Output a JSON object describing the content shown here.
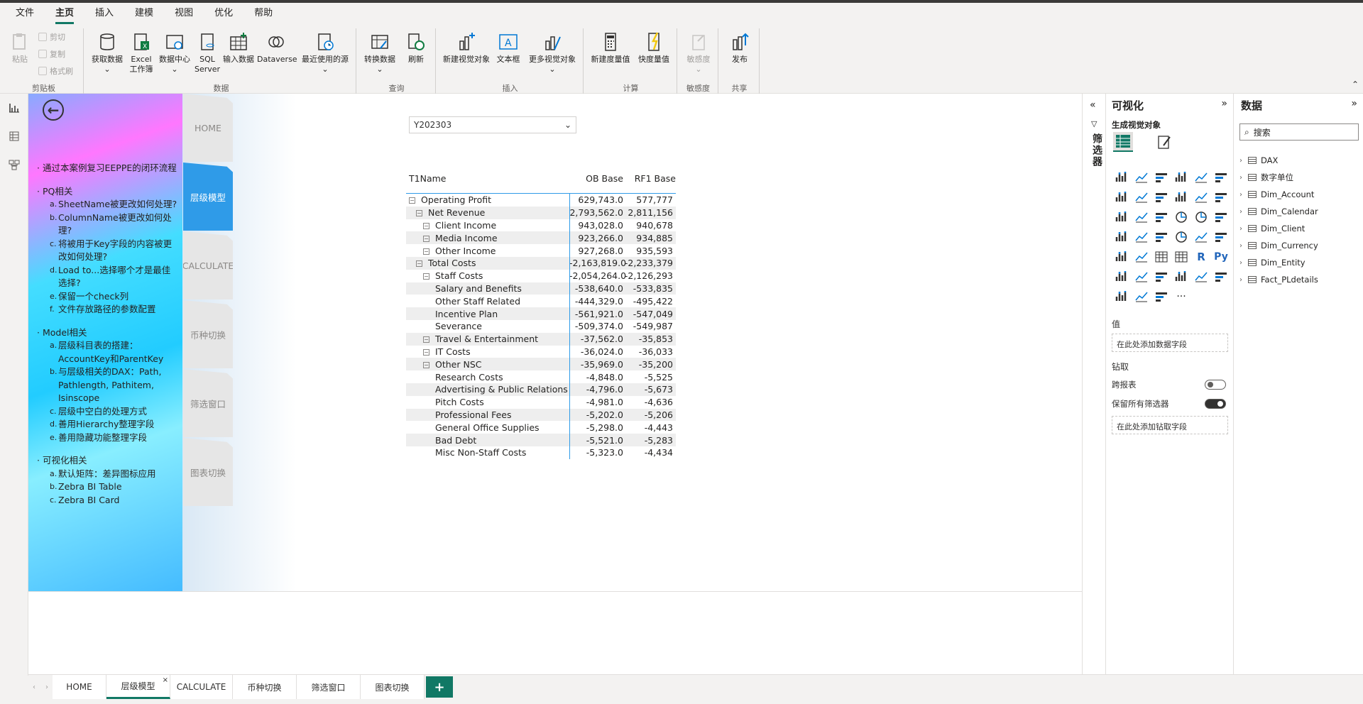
{
  "menu": [
    "文件",
    "主页",
    "插入",
    "建模",
    "视图",
    "优化",
    "帮助"
  ],
  "menu_active": "主页",
  "ribbon": {
    "clipboard": {
      "paste": "粘贴",
      "cut": "剪切",
      "copy": "复制",
      "format": "格式刷",
      "group": "剪贴板"
    },
    "data": {
      "get": "获取数据",
      "excel1": "Excel",
      "excel2": "工作簿",
      "hub": "数据中心",
      "sql1": "SQL",
      "sql2": "Server",
      "enter": "输入数据",
      "dataverse": "Dataverse",
      "recent": "最近使用的源",
      "group": "数据"
    },
    "query": {
      "transform": "转换数据",
      "refresh": "刷新",
      "group": "查询"
    },
    "insert": {
      "newvisual": "新建视觉对象",
      "textbox": "文本框",
      "morevisual": "更多视觉对象",
      "group": "插入"
    },
    "calc": {
      "newmeasure": "新建度量值",
      "quickmeasure": "快度量值",
      "group": "计算"
    },
    "sensitivity": {
      "label": "敏感度",
      "group": "敏感度"
    },
    "share": {
      "publish": "发布",
      "group": "共享"
    }
  },
  "outline": [
    {
      "title": "通过本案例复习EEPPE的闭环流程",
      "items": []
    },
    {
      "title": "PQ相关",
      "items": [
        {
          "m": "a.",
          "t": "SheetName被更改如何处理?"
        },
        {
          "m": "b.",
          "t": "ColumnName被更改如何处理?"
        },
        {
          "m": "c.",
          "t": "将被用于Key字段的内容被更改如何处理?"
        },
        {
          "m": "d.",
          "t": "Load to...选择哪个才是最佳选择?"
        },
        {
          "m": "e.",
          "t": "保留一个check列"
        },
        {
          "m": "f.",
          "t": "文件存放路径的参数配置"
        }
      ]
    },
    {
      "title": "Model相关",
      "items": [
        {
          "m": "a.",
          "t": "层级科目表的搭建：AccountKey和ParentKey"
        },
        {
          "m": "b.",
          "t": "与层级相关的DAX：Path, Pathlength, Pathitem, Isinscope"
        },
        {
          "m": "c.",
          "t": "层级中空白的处理方式"
        },
        {
          "m": "d.",
          "t": "善用Hierarchy整理字段"
        },
        {
          "m": "e.",
          "t": "善用隐藏功能整理字段"
        }
      ]
    },
    {
      "title": "可视化相关",
      "items": [
        {
          "m": "a.",
          "t": "默认矩阵：差异图标应用"
        },
        {
          "m": "b.",
          "t": "Zebra BI Table"
        },
        {
          "m": "c.",
          "t": "Zebra BI Card"
        }
      ]
    }
  ],
  "navtabs": [
    "HOME",
    "层级模型",
    "CALCULATE",
    "币种切换",
    "筛选窗口",
    "图表切换"
  ],
  "navtab_active": 1,
  "slicer": {
    "value": "Y202303"
  },
  "matrix": {
    "headers": [
      "T1Name",
      "OB Base",
      "RF1 Base"
    ],
    "rows": [
      {
        "name": "Operating Profit",
        "lvl": 0,
        "exp": true,
        "ob": "629,743.0",
        "rf": "577,777"
      },
      {
        "name": "Net Revenue",
        "lvl": 1,
        "exp": true,
        "ob": "2,793,562.0",
        "rf": "2,811,156"
      },
      {
        "name": "Client Income",
        "lvl": 2,
        "exp": true,
        "ob": "943,028.0",
        "rf": "940,678"
      },
      {
        "name": "Media Income",
        "lvl": 2,
        "exp": true,
        "ob": "923,266.0",
        "rf": "934,885"
      },
      {
        "name": "Other Income",
        "lvl": 2,
        "exp": true,
        "ob": "927,268.0",
        "rf": "935,593"
      },
      {
        "name": "Total Costs",
        "lvl": 1,
        "exp": true,
        "ob": "-2,163,819.0",
        "rf": "-2,233,379"
      },
      {
        "name": "Staff Costs",
        "lvl": 2,
        "exp": true,
        "ob": "-2,054,264.0",
        "rf": "-2,126,293"
      },
      {
        "name": "Salary and Benefits",
        "lvl": 3,
        "exp": false,
        "ob": "-538,640.0",
        "rf": "-533,835"
      },
      {
        "name": "Other Staff Related",
        "lvl": 3,
        "exp": false,
        "ob": "-444,329.0",
        "rf": "-495,422"
      },
      {
        "name": "Incentive Plan",
        "lvl": 3,
        "exp": false,
        "ob": "-561,921.0",
        "rf": "-547,049"
      },
      {
        "name": "Severance",
        "lvl": 3,
        "exp": false,
        "ob": "-509,374.0",
        "rf": "-549,987"
      },
      {
        "name": "Travel & Entertainment",
        "lvl": 2,
        "exp": true,
        "ob": "-37,562.0",
        "rf": "-35,853"
      },
      {
        "name": "IT Costs",
        "lvl": 2,
        "exp": true,
        "ob": "-36,024.0",
        "rf": "-36,033"
      },
      {
        "name": "Other NSC",
        "lvl": 2,
        "exp": true,
        "ob": "-35,969.0",
        "rf": "-35,200"
      },
      {
        "name": "Research Costs",
        "lvl": 3,
        "exp": false,
        "ob": "-4,848.0",
        "rf": "-5,525"
      },
      {
        "name": "Advertising & Public Relations",
        "lvl": 3,
        "exp": false,
        "ob": "-4,796.0",
        "rf": "-5,673"
      },
      {
        "name": "Pitch Costs",
        "lvl": 3,
        "exp": false,
        "ob": "-4,981.0",
        "rf": "-4,636"
      },
      {
        "name": "Professional Fees",
        "lvl": 3,
        "exp": false,
        "ob": "-5,202.0",
        "rf": "-5,206"
      },
      {
        "name": "General Office Supplies",
        "lvl": 3,
        "exp": false,
        "ob": "-5,298.0",
        "rf": "-4,443"
      },
      {
        "name": "Bad Debt",
        "lvl": 3,
        "exp": false,
        "ob": "-5,521.0",
        "rf": "-5,283"
      },
      {
        "name": "Misc Non-Staff Costs",
        "lvl": 3,
        "exp": false,
        "ob": "-5,323.0",
        "rf": "-4,434"
      }
    ]
  },
  "filters_title": "筛选器",
  "vis": {
    "title": "可视化",
    "build": "生成视觉对象",
    "values": "值",
    "values_well": "在此处添加数据字段",
    "drill": "钻取",
    "cross": "跨报表",
    "keep": "保留所有筛选器",
    "drill_well": "在此处添加钻取字段"
  },
  "data_pane": {
    "title": "数据",
    "search": "搜索",
    "tables": [
      "DAX",
      "数字单位",
      "Dim_Account",
      "Dim_Calendar",
      "Dim_Client",
      "Dim_Currency",
      "Dim_Entity",
      "Fact_PLdetails"
    ]
  },
  "pages": [
    "HOME",
    "层级模型",
    "CALCULATE",
    "币种切换",
    "筛选窗口",
    "图表切换"
  ],
  "page_active": 1,
  "colors": {
    "accent": "#117865",
    "highlight": "#2f9be8"
  }
}
